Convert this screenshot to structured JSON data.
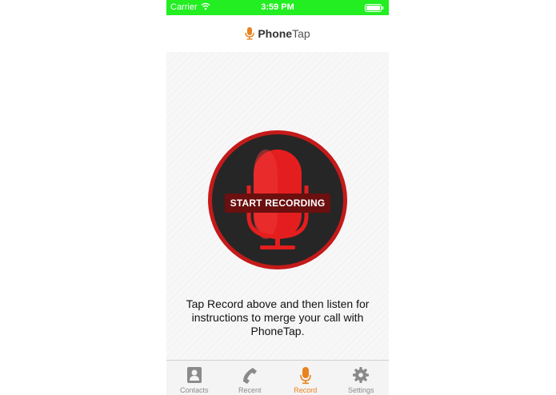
{
  "status_bar": {
    "carrier": "Carrier",
    "time": "3:59 PM",
    "background_color": "#22ee22"
  },
  "header": {
    "brand_part1": "Phone",
    "brand_part2": "Tap",
    "logo_icon": "microphone-icon"
  },
  "record": {
    "button_label": "START RECORDING",
    "mic_color": "#e41e1e",
    "ring_color": "#c41a1a",
    "disc_color": "#262626"
  },
  "instructions": "Tap Record above and then listen for instructions to merge your call with PhoneTap.",
  "tab_bar": {
    "active_color": "#e8831f",
    "items": [
      {
        "label": "Contacts",
        "icon": "contacts-icon"
      },
      {
        "label": "Recent",
        "icon": "phone-icon"
      },
      {
        "label": "Record",
        "icon": "microphone-icon",
        "active": true
      },
      {
        "label": "Settings",
        "icon": "gear-icon"
      }
    ]
  }
}
